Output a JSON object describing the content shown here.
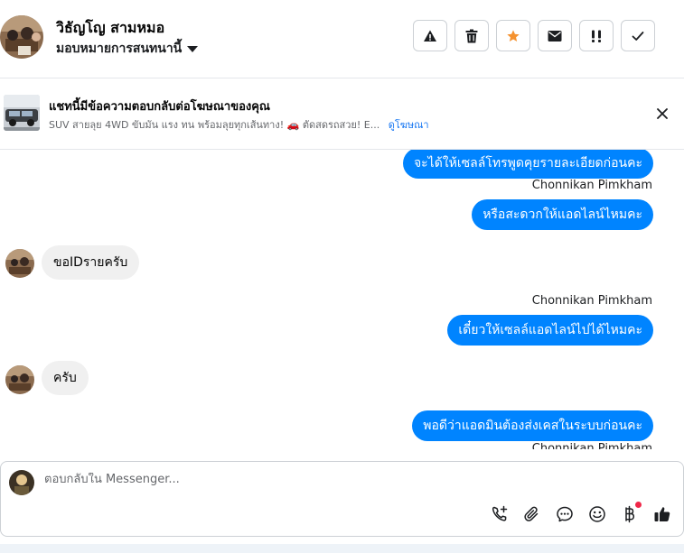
{
  "header": {
    "contact_name": "วิธัญโญ สามหมอ",
    "assign_label": "มอบหมายการสนทนานี้",
    "actions": [
      {
        "name": "spam-button",
        "icon": "warning-icon"
      },
      {
        "name": "delete-button",
        "icon": "trash-icon"
      },
      {
        "name": "star-button",
        "icon": "star-icon"
      },
      {
        "name": "mark-unread-button",
        "icon": "envelope-icon"
      },
      {
        "name": "follow-up-button",
        "icon": "exclamation-icon"
      },
      {
        "name": "done-button",
        "icon": "check-icon"
      }
    ]
  },
  "ad_banner": {
    "title": "แชทนี้มีข้อความตอบกลับต่อโฆษณาของคุณ",
    "description": "SUV สายลุย 4WD ขับมัน แรง ทน พร้อมลุยทุกเส้นทาง! 🚗 ตัดสดรถสวย! E...",
    "link": "ดูโฆษณา"
  },
  "messages": [
    {
      "direction": "out",
      "text": "จะได้ให้เซลล์โทรพูดคุยรายละเอียดก่อนคะ"
    },
    {
      "direction": "out",
      "sender": "Chonnikan Pimkham",
      "text": "หรือสะดวกให้แอดไลน์ไหมคะ"
    },
    {
      "direction": "in",
      "text": "ขอIDรายครับ"
    },
    {
      "direction": "out",
      "sender": "Chonnikan Pimkham",
      "text": "เดี๋ยวให้เซลล์แอดไลน์ไปได้ไหมคะ"
    },
    {
      "direction": "in",
      "text": "ครับ"
    },
    {
      "direction": "out",
      "text": "พอดีว่าแอดมินต้องส่งเคสในระบบก่อนคะ",
      "sender": "Chonnikan Pimkham"
    }
  ],
  "composer": {
    "placeholder": "ตอบกลับใน Messenger...",
    "value": "",
    "tools": [
      "phone-add-icon",
      "paperclip-icon",
      "saved-reply-icon",
      "emoji-icon",
      "baht-icon",
      "thumbs-up-icon"
    ]
  },
  "colors": {
    "accent": "#0084ff",
    "link": "#1877f2",
    "star": "#f5922f",
    "notification_dot": "#f02849"
  }
}
